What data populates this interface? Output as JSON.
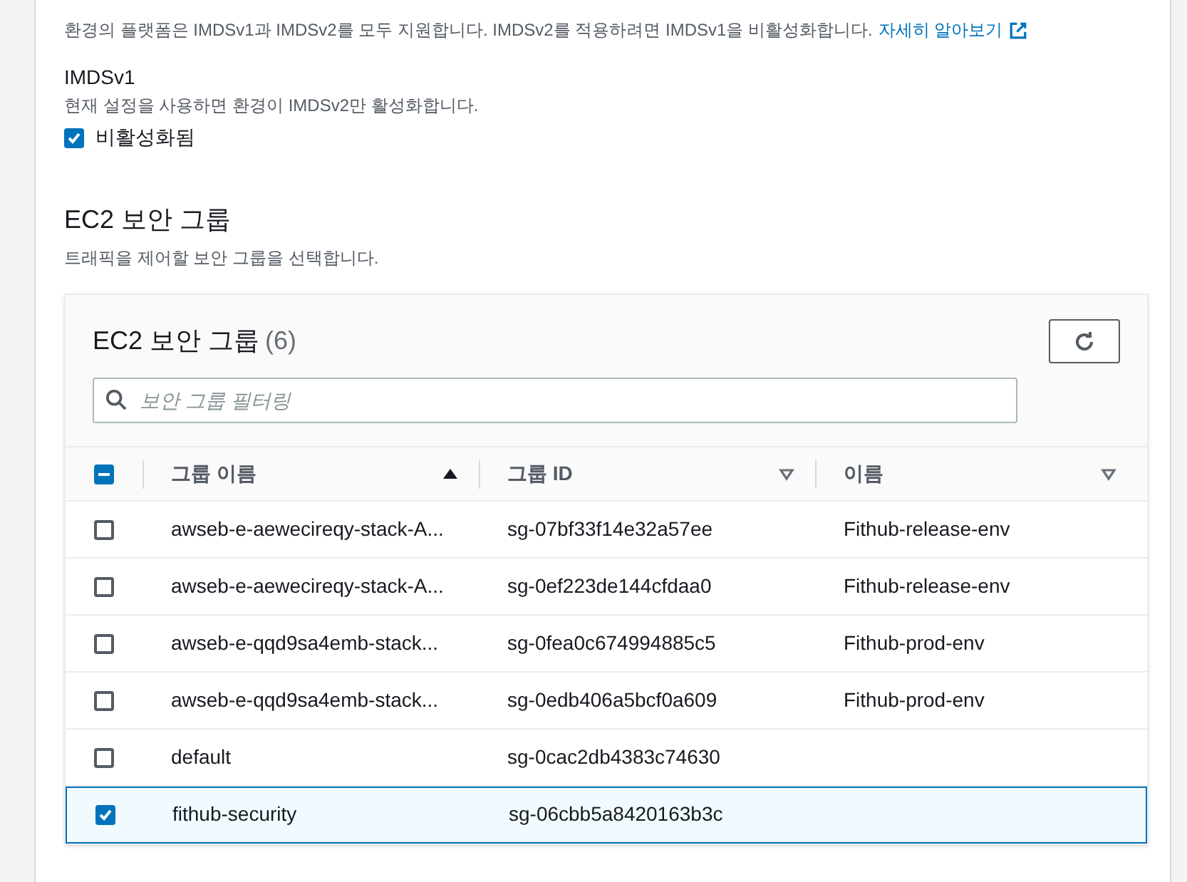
{
  "imds": {
    "description": "환경의 플랫폼은 IMDSv1과 IMDSv2를 모두 지원합니다. IMDSv2를 적용하려면 IMDSv1을 비활성화합니다.",
    "link": "자세히 알아보기",
    "field_label": "IMDSv1",
    "field_hint": "현재 설정을 사용하면 환경이 IMDSv2만 활성화합니다.",
    "checkbox": {
      "label": "비활성화됨",
      "checked": true
    }
  },
  "security_groups": {
    "title": "EC2 보안 그룹",
    "description": "트래픽을 제어할 보안 그룹을 선택합니다.",
    "table": {
      "title": "EC2 보안 그룹",
      "count": "(6)",
      "search": {
        "placeholder": "보안 그룹 필터링"
      },
      "select_all": {
        "indeterminate": true
      },
      "columns": [
        {
          "label": "그룹 이름",
          "sorted": true
        },
        {
          "label": "그룹 ID",
          "sorted": false
        },
        {
          "label": "이름",
          "sorted": false
        }
      ],
      "rows": [
        {
          "selected": false,
          "cells": [
            "awseb-e-aewecireqy-stack-A...",
            "sg-07bf33f14e32a57ee",
            "Fithub-release-env"
          ]
        },
        {
          "selected": false,
          "cells": [
            "awseb-e-aewecireqy-stack-A...",
            "sg-0ef223de144cfdaa0",
            "Fithub-release-env"
          ]
        },
        {
          "selected": false,
          "cells": [
            "awseb-e-qqd9sa4emb-stack...",
            "sg-0fea0c674994885c5",
            "Fithub-prod-env"
          ]
        },
        {
          "selected": false,
          "cells": [
            "awseb-e-qqd9sa4emb-stack...",
            "sg-0edb406a5bcf0a609",
            "Fithub-prod-env"
          ]
        },
        {
          "selected": false,
          "cells": [
            "default",
            "sg-0cac2db4383c74630"
          ]
        },
        {
          "selected": true,
          "cells": [
            "fithub-security",
            "sg-06cbb5a8420163b3c"
          ]
        }
      ]
    }
  }
}
